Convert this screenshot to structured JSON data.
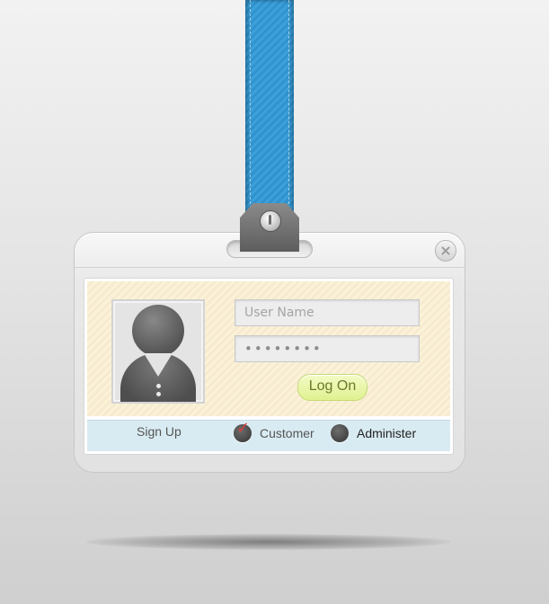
{
  "form": {
    "username_placeholder": "User Name",
    "password_value": "••••••••",
    "logon_label": "Log On"
  },
  "footer": {
    "signup_label": "Sign Up",
    "role_options": [
      {
        "label": "Customer",
        "selected": true
      },
      {
        "label": "Administer",
        "selected": false
      }
    ]
  },
  "colors": {
    "strap": "#2f93cf",
    "logon_button": "#dff191",
    "panel_top": "#fbf2d8",
    "panel_bottom": "#d9ebf2",
    "check": "#d43d3d"
  },
  "icons": {
    "close": "close-icon",
    "avatar": "user-avatar-icon",
    "clip": "badge-clip-icon",
    "check": "checkmark-icon"
  }
}
